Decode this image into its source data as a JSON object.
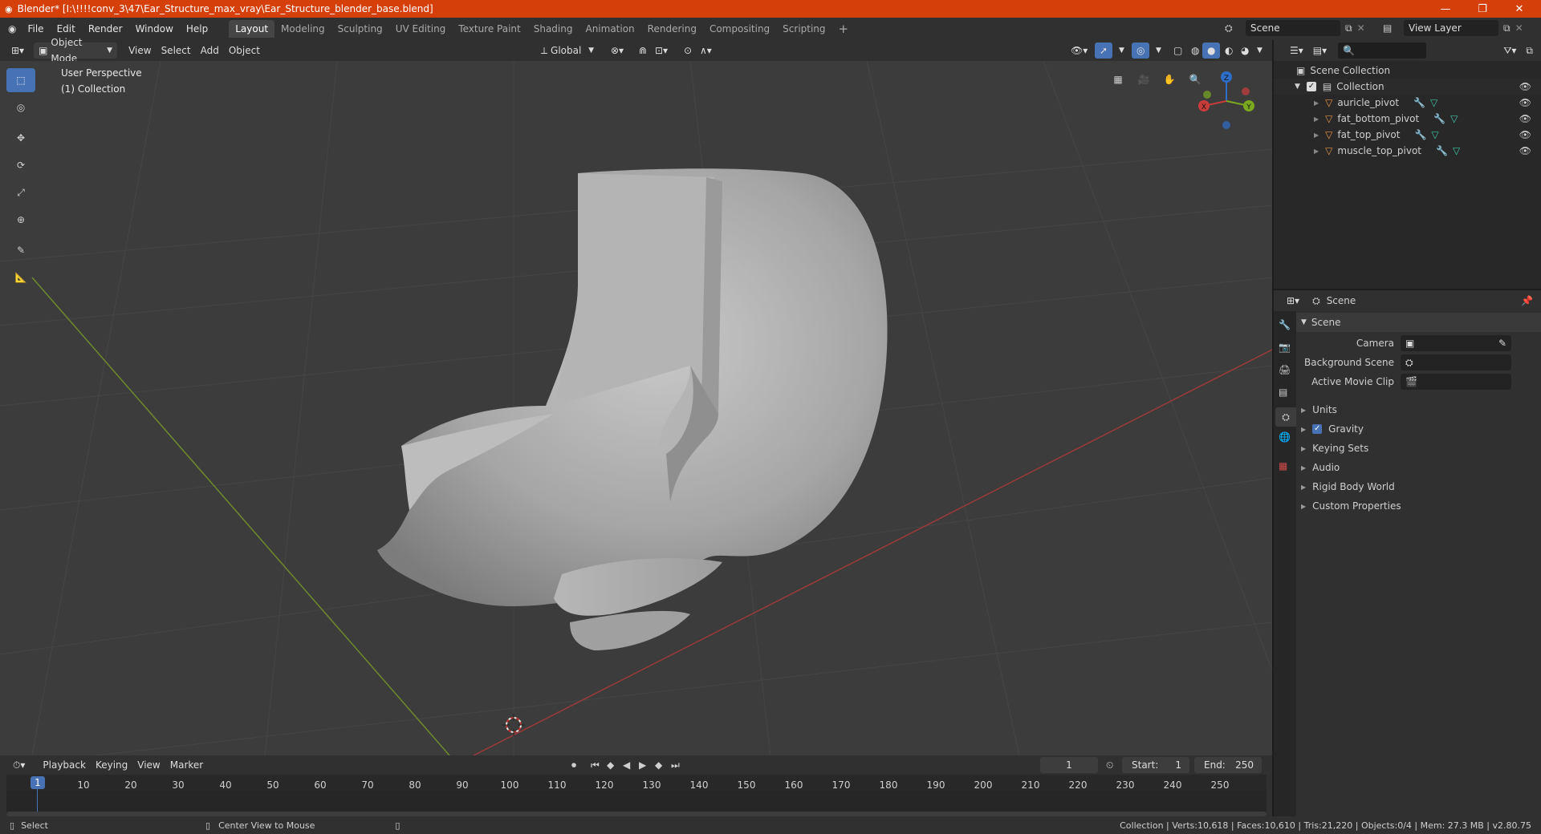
{
  "window": {
    "title": "Blender* [I:\\!!!!conv_3\\47\\Ear_Structure_max_vray\\Ear_Structure_blender_base.blend]",
    "minimize": "—",
    "maximize": "❐",
    "close": "✕",
    "accent": "#d5400a"
  },
  "menu": [
    "File",
    "Edit",
    "Render",
    "Window",
    "Help"
  ],
  "workspaces": [
    "Layout",
    "Modeling",
    "Sculpting",
    "UV Editing",
    "Texture Paint",
    "Shading",
    "Animation",
    "Rendering",
    "Compositing",
    "Scripting"
  ],
  "active_workspace": "Layout",
  "add_workspace": "+",
  "scene_selector": {
    "value": "Scene"
  },
  "view_layer_selector": {
    "value": "View Layer"
  },
  "viewport_header": {
    "mode": "Object Mode",
    "menus": [
      "View",
      "Select",
      "Add",
      "Object"
    ],
    "transform_orientation": "Global"
  },
  "viewport": {
    "perspective": "User Perspective",
    "collection": "(1) Collection",
    "gizmo_axes": {
      "x": "X",
      "y": "Y",
      "z": "Z"
    }
  },
  "outliner": {
    "root": "Scene Collection",
    "collection": "Collection",
    "items": [
      {
        "name": "auricle_pivot"
      },
      {
        "name": "fat_bottom_pivot"
      },
      {
        "name": "fat_top_pivot"
      },
      {
        "name": "muscle_top_pivot"
      }
    ]
  },
  "properties": {
    "context": "Scene",
    "panel_title": "Scene",
    "fields": [
      {
        "label": "Camera",
        "value": ""
      },
      {
        "label": "Background Scene",
        "value": ""
      },
      {
        "label": "Active Movie Clip",
        "value": ""
      }
    ],
    "sections": [
      "Units",
      "Gravity",
      "Keying Sets",
      "Audio",
      "Rigid Body World",
      "Custom Properties"
    ],
    "gravity_checked": true
  },
  "timeline": {
    "menus": [
      "Playback",
      "Keying",
      "View",
      "Marker"
    ],
    "current_frame": "1",
    "start_label": "Start:",
    "start": "1",
    "end_label": "End:",
    "end": "250",
    "ticks": [
      "1",
      "10",
      "20",
      "30",
      "40",
      "50",
      "60",
      "70",
      "80",
      "90",
      "100",
      "110",
      "120",
      "130",
      "140",
      "150",
      "160",
      "170",
      "180",
      "190",
      "200",
      "210",
      "220",
      "230",
      "240",
      "250"
    ]
  },
  "status": {
    "left_action": "Select",
    "middle_action": "Center View to Mouse",
    "stats": "Collection | Verts:10,618 | Faces:10,610 | Tris:21,220 | Objects:0/4 | Mem: 27.3 MB | v2.80.75"
  }
}
